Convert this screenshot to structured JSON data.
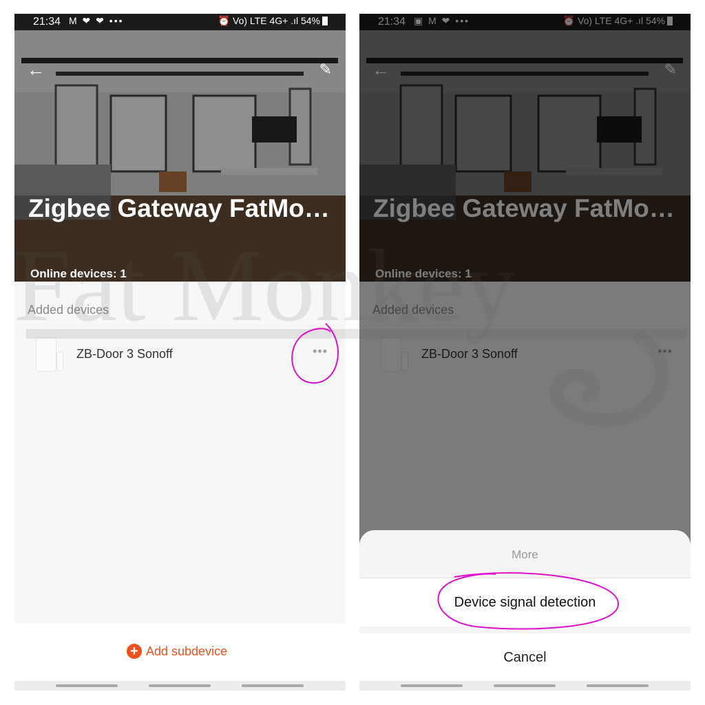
{
  "status_left": {
    "time": "21:34",
    "notif_icons": "M ❤ ❤  •••",
    "system": "⏰ Vo) LTE 4G+ .ıl 54%"
  },
  "status_right": {
    "time": "21:34",
    "notif_icons": "▣ M ❤  •••",
    "system": "⏰ Vo) LTE 4G+ .ıl 54%"
  },
  "hub": {
    "title": "Zigbee Gateway FatMonkey",
    "online_devices": "Online devices: 1"
  },
  "devices": {
    "section_label": "Added devices",
    "items": [
      {
        "name": "ZB-Door 3 Sonoff",
        "more": "•••"
      }
    ]
  },
  "actions": {
    "add_label": "Add subdevice",
    "add_icon": "+"
  },
  "sheet": {
    "title": "More",
    "option": "Device signal detection",
    "cancel": "Cancel"
  },
  "icons": {
    "back": "←",
    "edit": "✎"
  },
  "watermark": "Fat Monkey",
  "colors": {
    "accent": "#f0501e",
    "annotation": "#e010d0",
    "background": "#f7f7f7"
  }
}
